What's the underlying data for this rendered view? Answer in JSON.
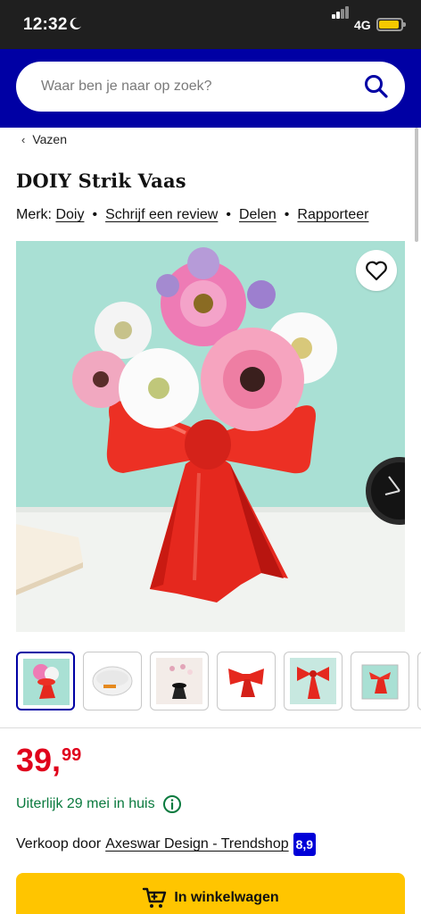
{
  "status_bar": {
    "time": "12:32",
    "network": "4G"
  },
  "search": {
    "placeholder": "Waar ben je naar op zoek?"
  },
  "breadcrumb": {
    "label": "Vazen"
  },
  "product": {
    "title": "DOIY Strik Vaas",
    "brand_prefix": "Merk:",
    "brand": "Doiy",
    "actions": [
      "Schrijf een review",
      "Delen",
      "Rapporteer"
    ],
    "thumbnails": [
      "thumbnail-vase-flowers",
      "thumbnail-bowl",
      "thumbnail-black-vase",
      "thumbnail-red-vase",
      "thumbnail-red-bow",
      "thumbnail-box"
    ],
    "price": {
      "main": "39,",
      "cents": "99"
    },
    "delivery": "Uiterlijk 29 mei in huis",
    "seller_prefix": "Verkoop door",
    "seller": "Axeswar Design - Trendshop",
    "seller_rating": "8,9"
  },
  "cart": {
    "label": "In winkelwagen"
  },
  "colors": {
    "brand_blue": "#0000a4",
    "price_red": "#e0001b",
    "delivery_green": "#0a7a3e",
    "cart_yellow": "#ffc500"
  }
}
